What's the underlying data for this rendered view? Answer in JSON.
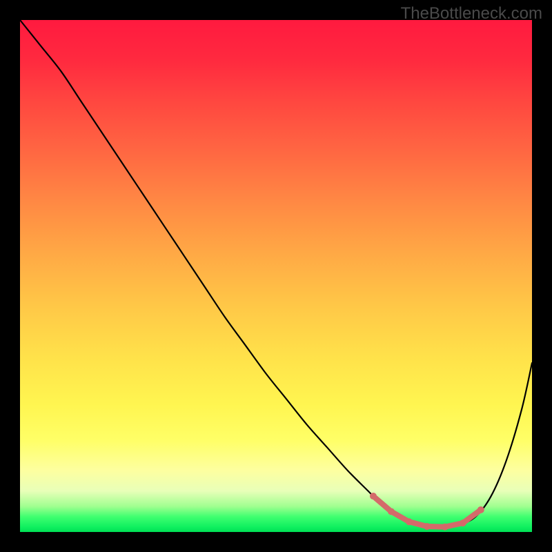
{
  "watermark": "TheBottleneck.com",
  "colors": {
    "background": "#000000",
    "gradient_top": "#ff1a3f",
    "gradient_bottom": "#00e055",
    "curve": "#000000",
    "highlight": "#d46a6a",
    "watermark": "#4a4a4a"
  },
  "chart_data": {
    "type": "line",
    "xlim": [
      0,
      100
    ],
    "ylim": [
      0,
      100
    ],
    "x": [
      0,
      4,
      8,
      12,
      16,
      20,
      24,
      28,
      32,
      36,
      40,
      44,
      48,
      52,
      56,
      60,
      64,
      68,
      71,
      74,
      77,
      80,
      83,
      86,
      89,
      92,
      95,
      98,
      100
    ],
    "y": [
      100,
      95,
      90,
      84,
      78,
      72,
      66,
      60,
      54,
      48,
      42,
      36.5,
      31,
      26,
      21,
      16.5,
      12,
      8,
      5,
      3,
      1.5,
      1,
      1,
      1.5,
      3,
      7,
      14,
      24,
      33
    ],
    "highlight_x_range": [
      69,
      90
    ],
    "title": "",
    "xlabel": "",
    "ylabel": ""
  }
}
